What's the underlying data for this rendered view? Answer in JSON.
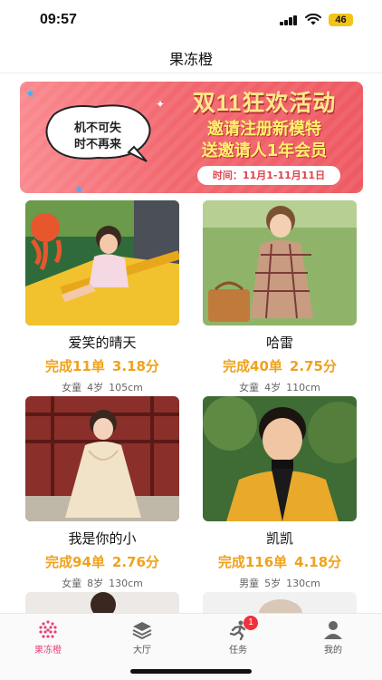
{
  "status_bar": {
    "time": "09:57",
    "battery": "46"
  },
  "header": {
    "title": "果冻橙"
  },
  "banner": {
    "bubble_line1": "机不可失",
    "bubble_line2": "时不再来",
    "title": "双11狂欢活动",
    "line1": "邀请注册新模特",
    "line2": "送邀请人1年会员",
    "date": "时间：11月1-11月11日"
  },
  "models": [
    {
      "name": "爱笑的晴天",
      "orders": "完成11单",
      "score": "3.18分",
      "gender": "女童",
      "age": "4岁",
      "height": "105cm"
    },
    {
      "name": "哈雷",
      "orders": "完成40单",
      "score": "2.75分",
      "gender": "女童",
      "age": "4岁",
      "height": "110cm"
    },
    {
      "name": "我是你的小",
      "orders": "完成94单",
      "score": "2.76分",
      "gender": "女童",
      "age": "8岁",
      "height": "130cm"
    },
    {
      "name": "凯凯",
      "orders": "完成116单",
      "score": "4.18分",
      "gender": "男童",
      "age": "5岁",
      "height": "130cm"
    }
  ],
  "tabs": [
    {
      "label": "果冻橙",
      "icon": "jelly-orange-icon",
      "active": true
    },
    {
      "label": "大厅",
      "icon": "layers-icon"
    },
    {
      "label": "任务",
      "icon": "runner-icon",
      "badge": "1"
    },
    {
      "label": "我的",
      "icon": "person-icon"
    }
  ],
  "colors": {
    "accent": "#f0a21c",
    "tab_active": "#e5427a",
    "banner_red": "#ee5a63",
    "badge_red": "#f0303a"
  }
}
